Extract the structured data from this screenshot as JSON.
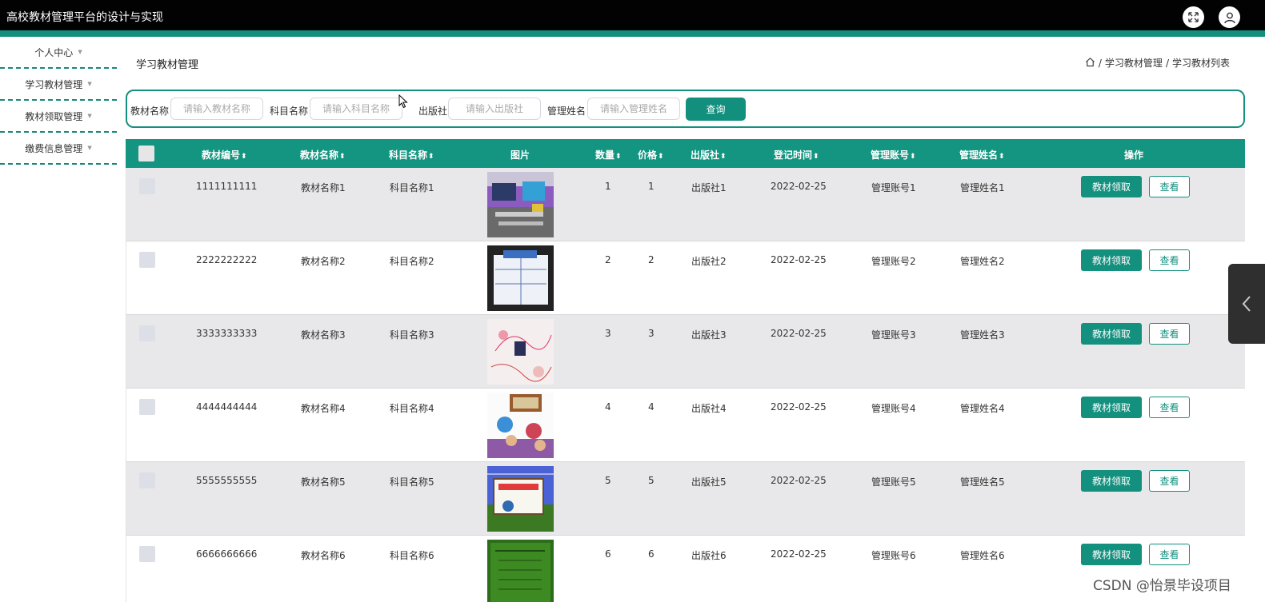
{
  "app": {
    "title": "高校教材管理平台的设计与实现"
  },
  "header": {
    "fullscreen_icon": "fullscreen-icon",
    "user_icon": "user-icon"
  },
  "sidebar": {
    "items": [
      {
        "label": "个人中心"
      },
      {
        "label": "学习教材管理"
      },
      {
        "label": "教材领取管理"
      },
      {
        "label": "缴费信息管理"
      }
    ]
  },
  "page": {
    "title": "学习教材管理",
    "breadcrumb": [
      "学习教材管理",
      "学习教材列表"
    ]
  },
  "search": {
    "fields": [
      {
        "label": "教材名称",
        "placeholder": "请输入教材名称",
        "value": ""
      },
      {
        "label": "科目名称",
        "placeholder": "请输入科目名称",
        "value": ""
      },
      {
        "label": "出版社",
        "placeholder": "请输入出版社",
        "value": ""
      },
      {
        "label": "管理姓名",
        "placeholder": "请输入管理姓名",
        "value": ""
      }
    ],
    "button_label": "查询"
  },
  "table": {
    "columns": [
      "教材编号",
      "教材名称",
      "科目名称",
      "图片",
      "数量",
      "价格",
      "出版社",
      "登记时间",
      "管理账号",
      "管理姓名",
      "操作"
    ],
    "action_labels": {
      "claim": "教材领取",
      "view": "查看"
    },
    "rows": [
      {
        "id": "1111111111",
        "name": "教材名称1",
        "subject": "科目名称1",
        "qty": "1",
        "price": "1",
        "publisher": "出版社1",
        "date": "2022-02-25",
        "account": "管理账号1",
        "manager": "管理姓名1"
      },
      {
        "id": "2222222222",
        "name": "教材名称2",
        "subject": "科目名称2",
        "qty": "2",
        "price": "2",
        "publisher": "出版社2",
        "date": "2022-02-25",
        "account": "管理账号2",
        "manager": "管理姓名2"
      },
      {
        "id": "3333333333",
        "name": "教材名称3",
        "subject": "科目名称3",
        "qty": "3",
        "price": "3",
        "publisher": "出版社3",
        "date": "2022-02-25",
        "account": "管理账号3",
        "manager": "管理姓名3"
      },
      {
        "id": "4444444444",
        "name": "教材名称4",
        "subject": "科目名称4",
        "qty": "4",
        "price": "4",
        "publisher": "出版社4",
        "date": "2022-02-25",
        "account": "管理账号4",
        "manager": "管理姓名4"
      },
      {
        "id": "5555555555",
        "name": "教材名称5",
        "subject": "科目名称5",
        "qty": "5",
        "price": "5",
        "publisher": "出版社5",
        "date": "2022-02-25",
        "account": "管理账号5",
        "manager": "管理姓名5"
      },
      {
        "id": "6666666666",
        "name": "教材名称6",
        "subject": "科目名称6",
        "qty": "6",
        "price": "6",
        "publisher": "出版社6",
        "date": "2022-02-25",
        "account": "管理账号6",
        "manager": "管理姓名6"
      }
    ]
  },
  "watermark": "CSDN @怡景毕设项目",
  "colors": {
    "topbar": "#020202",
    "accent": "#12907d",
    "row_alt": "#e8e8ea"
  }
}
